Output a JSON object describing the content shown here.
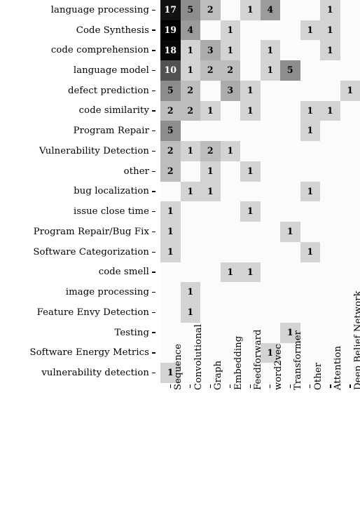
{
  "chart_data": {
    "type": "heatmap",
    "title": "",
    "xlabel": "",
    "ylabel": "",
    "grid": false,
    "legend": "none",
    "colormap": "greys",
    "value_range": [
      0,
      19
    ],
    "blank_when_zero": true,
    "x_categories": [
      "Sequence",
      "Convolutional",
      "Graph",
      "Embedding",
      "Feedforward",
      "word2vec",
      "Transformer",
      "Other",
      "Attention",
      "Deep Belief Network"
    ],
    "y_categories": [
      "language processing",
      "Code Synthesis",
      "code comprehension",
      "language model",
      "defect prediction",
      "code similarity",
      "Program Repair",
      "Vulnerability Detection",
      "other",
      "bug localization",
      "issue close time",
      "Program Repair/Bug Fix",
      "Software Categorization",
      "code smell",
      "image processing",
      "Feature Envy Detection",
      "Testing",
      "Software Energy Metrics",
      "vulnerability detection"
    ],
    "values": [
      [
        17,
        5,
        2,
        0,
        1,
        4,
        0,
        0,
        1,
        0
      ],
      [
        19,
        4,
        0,
        1,
        0,
        0,
        0,
        1,
        1,
        0
      ],
      [
        18,
        1,
        3,
        1,
        0,
        1,
        0,
        0,
        1,
        0
      ],
      [
        10,
        1,
        2,
        2,
        0,
        1,
        5,
        0,
        0,
        0
      ],
      [
        5,
        2,
        0,
        3,
        1,
        0,
        0,
        0,
        0,
        1
      ],
      [
        2,
        2,
        1,
        0,
        1,
        0,
        0,
        1,
        1,
        0
      ],
      [
        5,
        0,
        0,
        0,
        0,
        0,
        0,
        1,
        0,
        0
      ],
      [
        2,
        1,
        2,
        1,
        0,
        0,
        0,
        0,
        0,
        0
      ],
      [
        2,
        0,
        1,
        0,
        1,
        0,
        0,
        0,
        0,
        0
      ],
      [
        0,
        1,
        1,
        0,
        0,
        0,
        0,
        1,
        0,
        0
      ],
      [
        1,
        0,
        0,
        0,
        1,
        0,
        0,
        0,
        0,
        0
      ],
      [
        1,
        0,
        0,
        0,
        0,
        0,
        1,
        0,
        0,
        0
      ],
      [
        1,
        0,
        0,
        0,
        0,
        0,
        0,
        1,
        0,
        0
      ],
      [
        0,
        0,
        0,
        1,
        1,
        0,
        0,
        0,
        0,
        0
      ],
      [
        0,
        1,
        0,
        0,
        0,
        0,
        0,
        0,
        0,
        0
      ],
      [
        0,
        1,
        0,
        0,
        0,
        0,
        0,
        0,
        0,
        0
      ],
      [
        0,
        0,
        0,
        0,
        0,
        0,
        1,
        0,
        0,
        0
      ],
      [
        0,
        0,
        0,
        0,
        0,
        1,
        0,
        0,
        0,
        0
      ],
      [
        1,
        0,
        0,
        0,
        0,
        0,
        0,
        0,
        0,
        0
      ]
    ]
  },
  "axes": {
    "x_tick_bold_indices": [
      8,
      9
    ]
  }
}
